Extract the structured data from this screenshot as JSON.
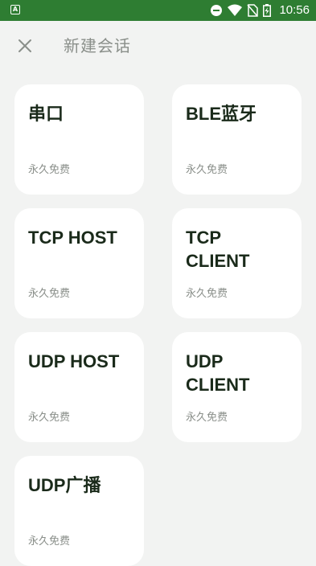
{
  "status_bar": {
    "app_icon_letter": "A",
    "time": "10:56",
    "icons": [
      "do-not-disturb-icon",
      "wifi-icon",
      "no-sim-icon",
      "battery-charging-icon"
    ]
  },
  "header": {
    "title": "新建会话",
    "close_icon": "close-icon"
  },
  "sessions": [
    {
      "title": "串口",
      "subtitle": "永久免费"
    },
    {
      "title": "BLE蓝牙",
      "subtitle": "永久免费"
    },
    {
      "title": "TCP HOST",
      "subtitle": "永久免费"
    },
    {
      "title": "TCP CLIENT",
      "subtitle": "永久免费"
    },
    {
      "title": "UDP HOST",
      "subtitle": "永久免费"
    },
    {
      "title": "UDP CLIENT",
      "subtitle": "永久免费"
    },
    {
      "title": "UDP广播",
      "subtitle": "永久免费"
    }
  ],
  "colors": {
    "status_bar": "#2e7d32",
    "background": "#f2f3f2",
    "card": "#ffffff",
    "title_text": "#1a2a1a",
    "muted_text": "#8a8f8a"
  }
}
